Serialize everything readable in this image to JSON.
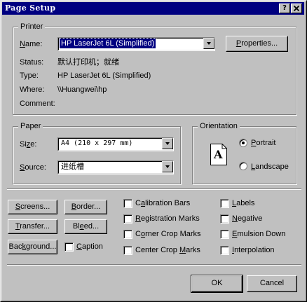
{
  "window": {
    "title": "Page Setup",
    "help_glyph": "?",
    "close_glyph": "✕"
  },
  "printer": {
    "legend": "Printer",
    "name_label": "Name:",
    "name_value": "HP LaserJet 6L (Simplified)",
    "properties_label": "Properties...",
    "status_label": "Status:",
    "status_value": "默认打印机；就绪",
    "type_label": "Type:",
    "type_value": "HP LaserJet 6L (Simplified)",
    "where_label": "Where:",
    "where_value": "\\\\Huangwei\\hp",
    "comment_label": "Comment:",
    "comment_value": ""
  },
  "paper": {
    "legend": "Paper",
    "size_label": "Size:",
    "size_value": "A4  (210 x 297 mm)",
    "source_label": "Source:",
    "source_value": "进纸槽"
  },
  "orientation": {
    "legend": "Orientation",
    "icon_letter": "A",
    "portrait_label": "Portrait",
    "landscape_label": "Landscape",
    "selected": "Portrait"
  },
  "buttons": {
    "screens": "Screens...",
    "border": "Border...",
    "transfer": "Transfer...",
    "bleed": "Bleed...",
    "background": "Background...",
    "ok": "OK",
    "cancel": "Cancel"
  },
  "options": {
    "caption": "Caption",
    "calibration_bars": "Calibration Bars",
    "registration_marks": "Registration Marks",
    "corner_crop_marks": "Corner Crop Marks",
    "center_crop_marks": "Center Crop Marks",
    "labels": "Labels",
    "negative": "Negative",
    "emulsion_down": "Emulsion Down",
    "interpolation": "Interpolation"
  },
  "colors": {
    "titlebar": "#000080",
    "face": "#c0c0c0",
    "selection": "#000080"
  }
}
